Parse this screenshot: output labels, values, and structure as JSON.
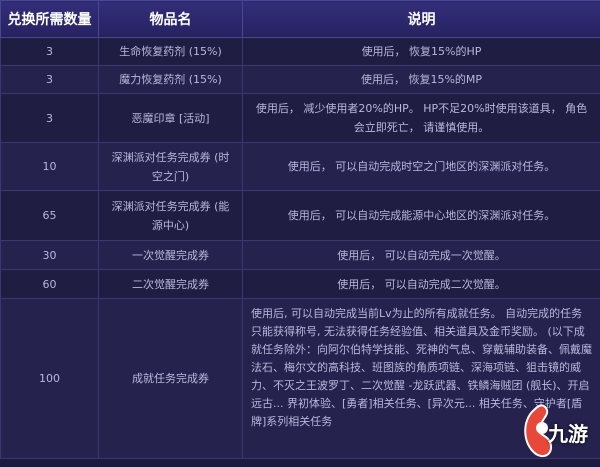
{
  "headers": [
    "兑换所需数量",
    "物品名",
    "说明"
  ],
  "rows": [
    {
      "qty": "3",
      "name": "生命恢复药剂 (15%)",
      "desc": "使用后， 恢复15%的HP"
    },
    {
      "qty": "3",
      "name": "魔力恢复药剂 (15%)",
      "desc": "使用后， 恢复15%的MP"
    },
    {
      "qty": "3",
      "name": "恶魔印章 [活动]",
      "desc": "使用后， 减少使用者20%的HP。 HP不足20%时使用该道具， 角色会立即死亡， 请谨慎使用。"
    },
    {
      "qty": "10",
      "name": "深渊派对任务完成券 (时空之门)",
      "desc": "使用后， 可以自动完成时空之门地区的深渊派对任务。"
    },
    {
      "qty": "65",
      "name": "深渊派对任务完成券 (能源中心)",
      "desc": "使用后， 可以自动完成能源中心地区的深渊派对任务。"
    },
    {
      "qty": "30",
      "name": "一次觉醒完成券",
      "desc": "使用后， 可以自动完成一次觉醒。"
    },
    {
      "qty": "60",
      "name": "二次觉醒完成券",
      "desc": "使用后， 可以自动完成二次觉醒。"
    },
    {
      "qty": "100",
      "name": "成就任务完成券",
      "desc": "使用后, 可以自动完成当前Lv为止的所有成就任务。 自动完成的任务只能获得称号, 无法获得任务经验值、相关道具及金币奖励。 (以下成就任务除外：向阿尔伯特学技能、死神的气息、穿戴辅助装备、佩戴魔法石、梅尔文的高科技、班图族的角质项链、深海项链、狙击镜的威力、不灭之王波罗丁、二次觉醒 -龙跃武器、铁鳞海贼团 (舰长)、开启远古... 界初体验、[勇者]相关任务、[异次元... 相关任务、守护者[盾牌]系列相关任务"
    }
  ],
  "watermark": {
    "left_text": "",
    "logo_text": "九游",
    "logo_color": "#e8483a"
  },
  "colors": {
    "header_bg": "#2b2769",
    "row_odd": "#1f1d42",
    "row_even": "#25234d",
    "text": "#b9b7dc"
  }
}
